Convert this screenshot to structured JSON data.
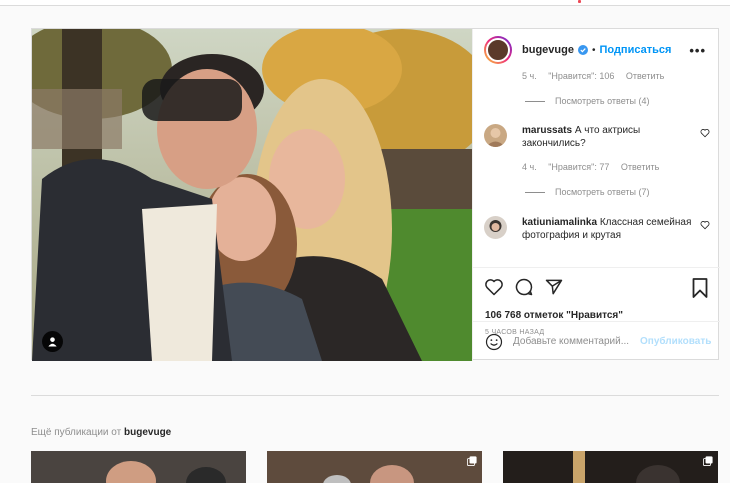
{
  "post": {
    "username": "bugevuge",
    "separator": "•",
    "follow_label": "Подписаться",
    "more_label": "•••",
    "likes": "106 768 отметок \"Нравится\"",
    "time": "5 ЧАСОВ НАЗАД",
    "comment_placeholder": "Добавьте комментарий...",
    "publish_label": "Опубликовать"
  },
  "comments": {
    "first_meta": {
      "age": "5 ч.",
      "likes": "\"Нравится\": 106",
      "reply": "Ответить"
    },
    "first_replies": "Посмотреть ответы (4)",
    "items": [
      {
        "user": "marussats",
        "text": "А что актрисы закончились?",
        "age": "4 ч.",
        "likes": "\"Нравится\": 77",
        "reply": "Ответить",
        "replies": "Посмотреть ответы (7)"
      },
      {
        "user": "katiuniamalinka",
        "text": "Классная семейная  фотография и крутая"
      }
    ]
  },
  "more_publications": {
    "prefix": "Ещё публикации от",
    "user": "bugevuge"
  },
  "colors": {
    "link": "#0095f6",
    "muted": "#8e8e8e",
    "border": "#dbdbdb"
  }
}
